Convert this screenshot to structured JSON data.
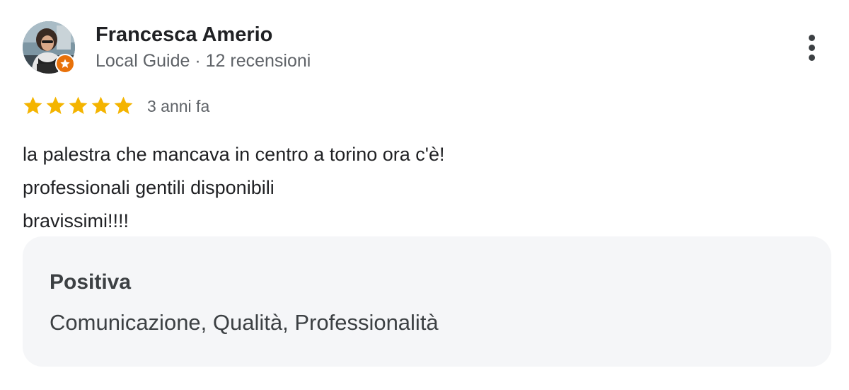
{
  "review": {
    "author_name": "Francesca Amerio",
    "author_meta": "Local Guide · 12 recensioni",
    "avatar_icon": "person-photo-icon",
    "badge_icon": "local-guide-star-icon",
    "menu_icon": "more-vert-icon",
    "rating": 5,
    "rating_max": 5,
    "star_color": "#f4b400",
    "date": "3 anni fa",
    "text_lines": [
      "la palestra che mancava in centro a torino ora c'è!",
      "professionali gentili disponibili",
      "bravissimi!!!!"
    ]
  },
  "attributes": {
    "heading": "Positiva",
    "values": "Comunicazione, Qualità, Professionalità"
  },
  "colors": {
    "badge": "#e8710a",
    "box_background": "#f5f6f8",
    "meta_text": "#5f6368"
  }
}
